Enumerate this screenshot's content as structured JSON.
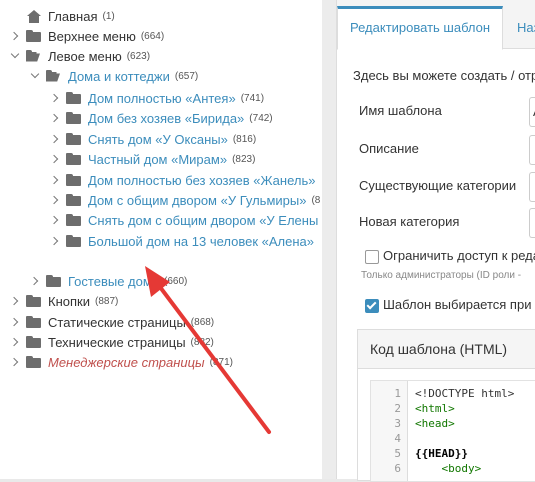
{
  "tree": {
    "items": [
      {
        "name": "tree-item-glavnaya",
        "label": "Главная",
        "count": "(1)",
        "icon": "home-icon",
        "chev": "none",
        "style": "plain"
      },
      {
        "name": "tree-item-verhnee-menyu",
        "label": "Верхнее меню",
        "count": "(664)",
        "icon": "folder-icon",
        "chev": "right",
        "style": "plain"
      },
      {
        "name": "tree-item-levoe-menyu",
        "label": "Левое меню",
        "count": "(623)",
        "icon": "folder-open-icon",
        "chev": "down",
        "style": "plain"
      },
      {
        "name": "tree-item-doma-i-kottedzhi",
        "label": "Дома и коттеджи",
        "count": "(657)",
        "icon": "folder-open-icon",
        "chev": "down",
        "style": "link"
      },
      {
        "name": "tree-item-dom-antey",
        "label": "Дом полностью «Антея»",
        "count": "(741)",
        "icon": "folder-icon",
        "chev": "right",
        "style": "link"
      },
      {
        "name": "tree-item-dom-birida",
        "label": "Дом без хозяев «Бирида»",
        "count": "(742)",
        "icon": "folder-icon",
        "chev": "right",
        "style": "link"
      },
      {
        "name": "tree-item-oksana",
        "label": "Снять дом «У Оксаны»",
        "count": "(816)",
        "icon": "folder-icon",
        "chev": "right",
        "style": "link"
      },
      {
        "name": "tree-item-miram",
        "label": "Частный дом «Мирам»",
        "count": "(823)",
        "icon": "folder-icon",
        "chev": "right",
        "style": "link"
      },
      {
        "name": "tree-item-zhanel",
        "label": "Дом полностью без хозяев «Жанель»",
        "count": "",
        "icon": "folder-icon",
        "chev": "right",
        "style": "link"
      },
      {
        "name": "tree-item-gulmira",
        "label": "Дом с общим двором «У Гульмиры»",
        "count": "(8",
        "icon": "folder-icon",
        "chev": "right",
        "style": "link"
      },
      {
        "name": "tree-item-elena",
        "label": "Снять дом с общим двором «У Елены",
        "count": "",
        "icon": "folder-icon",
        "chev": "right",
        "style": "link"
      },
      {
        "name": "tree-item-alena",
        "label": "Большой дом на 13 человек «Алена»",
        "count": "",
        "icon": "folder-icon",
        "chev": "right",
        "style": "link"
      },
      {
        "name": "tree-item-gostevye-doma",
        "label": "Гостевые дома",
        "count": "(660)",
        "icon": "folder-icon",
        "chev": "right",
        "style": "link"
      },
      {
        "name": "tree-item-knopki",
        "label": "Кнопки",
        "count": "(887)",
        "icon": "folder-icon",
        "chev": "right",
        "style": "plain"
      },
      {
        "name": "tree-item-staticheskie",
        "label": "Статические страницы",
        "count": "(868)",
        "icon": "folder-icon",
        "chev": "right",
        "style": "plain"
      },
      {
        "name": "tree-item-tehnicheskie",
        "label": "Технические страницы",
        "count": "(882)",
        "icon": "folder-icon",
        "chev": "right",
        "style": "plain"
      },
      {
        "name": "tree-item-menedzherskie",
        "label": "Менеджерские страницы",
        "count": "(871)",
        "icon": "folder-icon",
        "chev": "right",
        "style": "muted"
      }
    ]
  },
  "panel": {
    "tabs": [
      {
        "label": "Редактировать шаблон",
        "active": true
      },
      {
        "label": "Наз",
        "active": false
      }
    ],
    "intro": "Здесь вы можете создать / отр",
    "fields": {
      "template_name": "Имя шаблона",
      "template_name_value": "А",
      "description": "Описание",
      "existing_categories": "Существующие категории",
      "new_category": "Новая категория"
    },
    "restrict_access": {
      "label": "Ограничить доступ к реда",
      "checked": false
    },
    "admins_note": "Только администраторы (ID роли -",
    "template_select": {
      "label": "Шаблон выбирается при",
      "checked": true
    },
    "code_header": "Код шаблона (HTML)",
    "code_lines": [
      {
        "n": "1",
        "text": "<!DOCTYPE html>",
        "cls": "plain"
      },
      {
        "n": "2",
        "text": "<html>",
        "cls": "tag"
      },
      {
        "n": "3",
        "text": "<head>",
        "cls": "tag"
      },
      {
        "n": "4",
        "text": "",
        "cls": "plain"
      },
      {
        "n": "5",
        "text": "{{HEAD}}",
        "cls": "bold"
      },
      {
        "n": "6",
        "text": "    <body>",
        "cls": "tag"
      }
    ]
  },
  "colors": {
    "link": "#3c8dbc",
    "muted": "#c0504d",
    "arrow": "#e53935"
  }
}
